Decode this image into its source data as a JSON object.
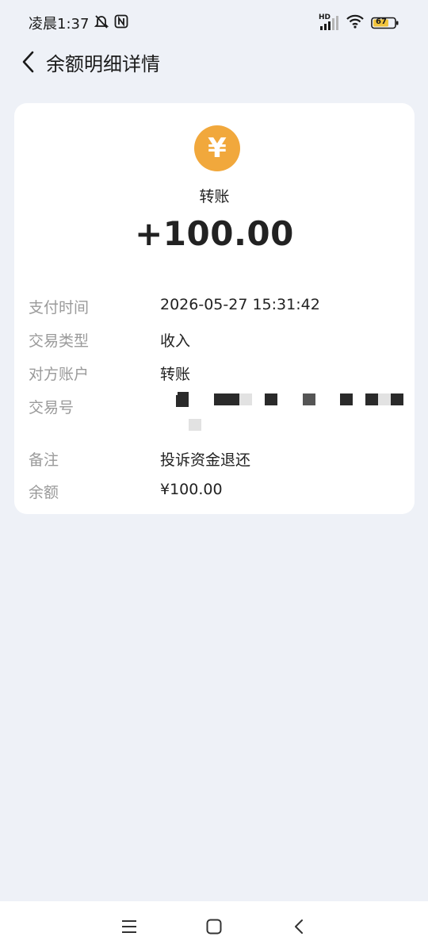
{
  "status": {
    "time": "凌晨1:37",
    "network": "HD",
    "battery": "67"
  },
  "header": {
    "title": "余额明细详情"
  },
  "detail": {
    "currency_symbol": "¥",
    "type": "转账",
    "amount": "+100.00",
    "rows": [
      {
        "label": "支付时间",
        "value": "2026-05-27 15:31:42"
      },
      {
        "label": "交易类型",
        "value": "收入"
      },
      {
        "label": "对方账户",
        "value": "转账"
      },
      {
        "label": "交易号",
        "value": ""
      },
      {
        "label": "备注",
        "value": "投诉资金退还"
      },
      {
        "label": "余额",
        "value": "¥100.00"
      }
    ]
  },
  "colors": {
    "accent": "#f1a83c",
    "background": "#eef1f7",
    "card": "#ffffff"
  }
}
